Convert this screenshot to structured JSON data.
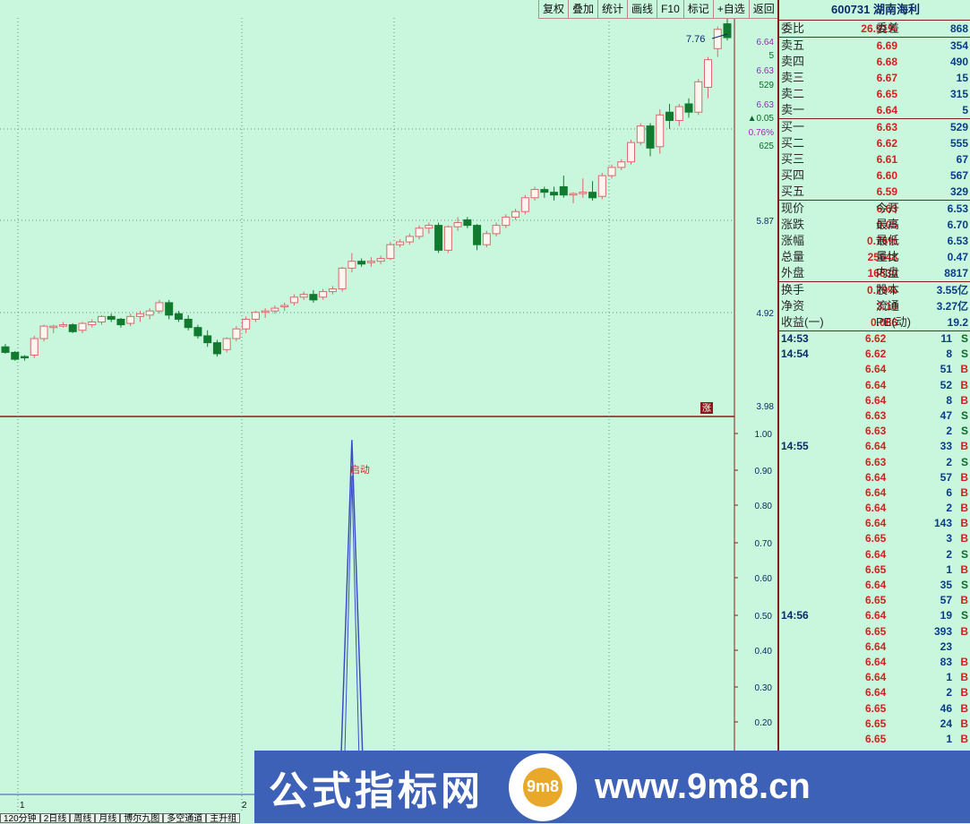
{
  "toolbar": [
    "复权",
    "叠加",
    "统计",
    "画线",
    "F10",
    "标记",
    "+自选",
    "返回"
  ],
  "stock": {
    "code": "600731",
    "name": "湖南海利"
  },
  "ratio": {
    "label": "委比",
    "value": "26.91%",
    "diff_label": "委差",
    "diff": "868"
  },
  "asks": [
    {
      "label": "卖五",
      "price": "6.69",
      "vol": "354"
    },
    {
      "label": "卖四",
      "price": "6.68",
      "vol": "490"
    },
    {
      "label": "卖三",
      "price": "6.67",
      "vol": "15"
    },
    {
      "label": "卖二",
      "price": "6.65",
      "vol": "315"
    },
    {
      "label": "卖一",
      "price": "6.64",
      "vol": "5"
    }
  ],
  "bids": [
    {
      "label": "买一",
      "price": "6.63",
      "vol": "529"
    },
    {
      "label": "买二",
      "price": "6.62",
      "vol": "555"
    },
    {
      "label": "买三",
      "price": "6.61",
      "vol": "67"
    },
    {
      "label": "买四",
      "price": "6.60",
      "vol": "567"
    },
    {
      "label": "买五",
      "price": "6.59",
      "vol": "329"
    }
  ],
  "quote": [
    {
      "l1": "现价",
      "v1": "6.63",
      "l2": "今开",
      "v2": "6.53"
    },
    {
      "l1": "涨跌",
      "v1": "0.05",
      "l2": "最高",
      "v2": "6.70"
    },
    {
      "l1": "涨幅",
      "v1": "0.76%",
      "l2": "最低",
      "v2": "6.53"
    },
    {
      "l1": "总量",
      "v1": "25648",
      "l2": "量比",
      "v2": "0.47"
    },
    {
      "l1": "外盘",
      "v1": "16830",
      "l2": "内盘",
      "v2": "8817"
    }
  ],
  "fund": [
    {
      "l1": "换手",
      "v1": "0.79%",
      "l2": "股本",
      "v2": "3.55亿"
    },
    {
      "l1": "净资",
      "v1": "3.10",
      "l2": "流通",
      "v2": "3.27亿"
    },
    {
      "l1": "收益(一)",
      "v1": "0.086",
      "l2": "PE(动)",
      "v2": "19.2"
    }
  ],
  "ticks": [
    {
      "t": "14:53",
      "p": "6.62",
      "v": "11",
      "d": "S"
    },
    {
      "t": "14:54",
      "p": "6.62",
      "v": "8",
      "d": "S"
    },
    {
      "t": "",
      "p": "6.64",
      "v": "51",
      "d": "B"
    },
    {
      "t": "",
      "p": "6.64",
      "v": "52",
      "d": "B"
    },
    {
      "t": "",
      "p": "6.64",
      "v": "8",
      "d": "B"
    },
    {
      "t": "",
      "p": "6.63",
      "v": "47",
      "d": "S"
    },
    {
      "t": "",
      "p": "6.63",
      "v": "2",
      "d": "S"
    },
    {
      "t": "14:55",
      "p": "6.64",
      "v": "33",
      "d": "B"
    },
    {
      "t": "",
      "p": "6.63",
      "v": "2",
      "d": "S"
    },
    {
      "t": "",
      "p": "6.64",
      "v": "57",
      "d": "B"
    },
    {
      "t": "",
      "p": "6.64",
      "v": "6",
      "d": "B"
    },
    {
      "t": "",
      "p": "6.64",
      "v": "2",
      "d": "B"
    },
    {
      "t": "",
      "p": "6.64",
      "v": "143",
      "d": "B"
    },
    {
      "t": "",
      "p": "6.65",
      "v": "3",
      "d": "B"
    },
    {
      "t": "",
      "p": "6.64",
      "v": "2",
      "d": "S"
    },
    {
      "t": "",
      "p": "6.65",
      "v": "1",
      "d": "B"
    },
    {
      "t": "",
      "p": "6.64",
      "v": "35",
      "d": "S"
    },
    {
      "t": "",
      "p": "6.65",
      "v": "57",
      "d": "B"
    },
    {
      "t": "14:56",
      "p": "6.64",
      "v": "19",
      "d": "S"
    },
    {
      "t": "",
      "p": "6.65",
      "v": "393",
      "d": "B"
    },
    {
      "t": "",
      "p": "6.64",
      "v": "23",
      "d": ""
    },
    {
      "t": "",
      "p": "6.64",
      "v": "83",
      "d": "B"
    },
    {
      "t": "",
      "p": "6.64",
      "v": "1",
      "d": "B"
    },
    {
      "t": "",
      "p": "6.64",
      "v": "2",
      "d": "B"
    },
    {
      "t": "",
      "p": "6.65",
      "v": "46",
      "d": "B"
    },
    {
      "t": "",
      "p": "6.65",
      "v": "24",
      "d": "B"
    },
    {
      "t": "",
      "p": "6.65",
      "v": "1",
      "d": "B"
    }
  ],
  "price_axis": [
    "6.64",
    "5",
    "6.63",
    "529",
    "6.63",
    "▲0.05",
    "0.76%",
    "625",
    "5.87",
    "4.92",
    "3.98"
  ],
  "max_label": "7.76",
  "zhang_label": "涨",
  "indicator_axis": [
    "1.00",
    "0.90",
    "0.80",
    "0.70",
    "0.60",
    "0.50",
    "0.40",
    "0.30",
    "0.20"
  ],
  "signal_label": "启动",
  "bottom_tabs": [
    "120分钟",
    "2日线",
    "周线",
    "月线",
    "博尔九图",
    "多空通道",
    "主升组"
  ],
  "x_markers": [
    "1",
    "2"
  ],
  "banner": {
    "cn": "公式指标网",
    "web": "www.9m8.cn",
    "logo": "9m8"
  },
  "chart_data": {
    "type": "candlestick",
    "price_ylim": [
      3.98,
      6.64
    ],
    "candles": [
      [
        4.4,
        4.42,
        4.35,
        4.36
      ],
      [
        4.36,
        4.37,
        4.3,
        4.31
      ],
      [
        4.33,
        4.34,
        4.3,
        4.32
      ],
      [
        4.34,
        4.48,
        4.32,
        4.46
      ],
      [
        4.46,
        4.56,
        4.44,
        4.55
      ],
      [
        4.54,
        4.56,
        4.5,
        4.55
      ],
      [
        4.55,
        4.58,
        4.54,
        4.56
      ],
      [
        4.56,
        4.57,
        4.5,
        4.51
      ],
      [
        4.52,
        4.58,
        4.5,
        4.57
      ],
      [
        4.56,
        4.6,
        4.54,
        4.58
      ],
      [
        4.58,
        4.63,
        4.56,
        4.62
      ],
      [
        4.62,
        4.64,
        4.58,
        4.6
      ],
      [
        4.6,
        4.61,
        4.54,
        4.56
      ],
      [
        4.57,
        4.64,
        4.55,
        4.62
      ],
      [
        4.62,
        4.66,
        4.58,
        4.64
      ],
      [
        4.63,
        4.68,
        4.6,
        4.66
      ],
      [
        4.66,
        4.74,
        4.64,
        4.72
      ],
      [
        4.72,
        4.74,
        4.6,
        4.63
      ],
      [
        4.64,
        4.66,
        4.58,
        4.6
      ],
      [
        4.6,
        4.63,
        4.52,
        4.54
      ],
      [
        4.54,
        4.56,
        4.46,
        4.48
      ],
      [
        4.48,
        4.52,
        4.4,
        4.43
      ],
      [
        4.43,
        4.45,
        4.33,
        4.35
      ],
      [
        4.38,
        4.47,
        4.36,
        4.46
      ],
      [
        4.46,
        4.55,
        4.44,
        4.53
      ],
      [
        4.53,
        4.62,
        4.5,
        4.6
      ],
      [
        4.6,
        4.66,
        4.58,
        4.65
      ],
      [
        4.65,
        4.68,
        4.61,
        4.66
      ],
      [
        4.66,
        4.7,
        4.64,
        4.68
      ],
      [
        4.69,
        4.72,
        4.66,
        4.7
      ],
      [
        4.72,
        4.78,
        4.7,
        4.76
      ],
      [
        4.76,
        4.8,
        4.74,
        4.78
      ],
      [
        4.78,
        4.81,
        4.72,
        4.74
      ],
      [
        4.76,
        4.82,
        4.74,
        4.8
      ],
      [
        4.8,
        4.84,
        4.78,
        4.82
      ],
      [
        4.82,
        4.98,
        4.8,
        4.97
      ],
      [
        4.97,
        5.08,
        4.94,
        5.02
      ],
      [
        5.02,
        5.04,
        4.98,
        5.0
      ],
      [
        5.01,
        5.05,
        4.98,
        5.02
      ],
      [
        5.02,
        5.06,
        5.0,
        5.04
      ],
      [
        5.04,
        5.16,
        5.03,
        5.14
      ],
      [
        5.14,
        5.18,
        5.12,
        5.16
      ],
      [
        5.16,
        5.22,
        5.14,
        5.2
      ],
      [
        5.2,
        5.28,
        5.18,
        5.26
      ],
      [
        5.26,
        5.3,
        5.22,
        5.28
      ],
      [
        5.28,
        5.3,
        5.08,
        5.1
      ],
      [
        5.1,
        5.28,
        5.08,
        5.27
      ],
      [
        5.27,
        5.34,
        5.24,
        5.3
      ],
      [
        5.32,
        5.34,
        5.26,
        5.28
      ],
      [
        5.28,
        5.29,
        5.1,
        5.14
      ],
      [
        5.14,
        5.24,
        5.12,
        5.22
      ],
      [
        5.22,
        5.3,
        5.2,
        5.28
      ],
      [
        5.28,
        5.36,
        5.26,
        5.34
      ],
      [
        5.34,
        5.4,
        5.32,
        5.38
      ],
      [
        5.38,
        5.5,
        5.36,
        5.48
      ],
      [
        5.48,
        5.56,
        5.46,
        5.54
      ],
      [
        5.54,
        5.56,
        5.48,
        5.52
      ],
      [
        5.52,
        5.56,
        5.46,
        5.5
      ],
      [
        5.56,
        5.64,
        5.48,
        5.5
      ],
      [
        5.5,
        5.52,
        5.44,
        5.51
      ],
      [
        5.51,
        5.62,
        5.48,
        5.52
      ],
      [
        5.52,
        5.6,
        5.46,
        5.48
      ],
      [
        5.49,
        5.66,
        5.47,
        5.64
      ],
      [
        5.64,
        5.72,
        5.62,
        5.7
      ],
      [
        5.7,
        5.76,
        5.68,
        5.74
      ],
      [
        5.74,
        5.9,
        5.72,
        5.88
      ],
      [
        5.88,
        6.02,
        5.86,
        6.0
      ],
      [
        6.0,
        6.02,
        5.78,
        5.84
      ],
      [
        5.85,
        6.12,
        5.8,
        6.08
      ],
      [
        6.1,
        6.16,
        5.98,
        6.04
      ],
      [
        6.04,
        6.16,
        6.0,
        6.14
      ],
      [
        6.16,
        6.2,
        6.06,
        6.1
      ],
      [
        6.1,
        6.34,
        6.08,
        6.32
      ],
      [
        6.28,
        6.5,
        6.2,
        6.48
      ],
      [
        6.56,
        6.72,
        6.5,
        6.7
      ],
      [
        6.74,
        6.8,
        6.62,
        6.64
      ]
    ],
    "indicator_ylim": [
      0,
      1
    ],
    "indicator": {
      "peak_index": 36,
      "peak_value": 1.0
    }
  }
}
